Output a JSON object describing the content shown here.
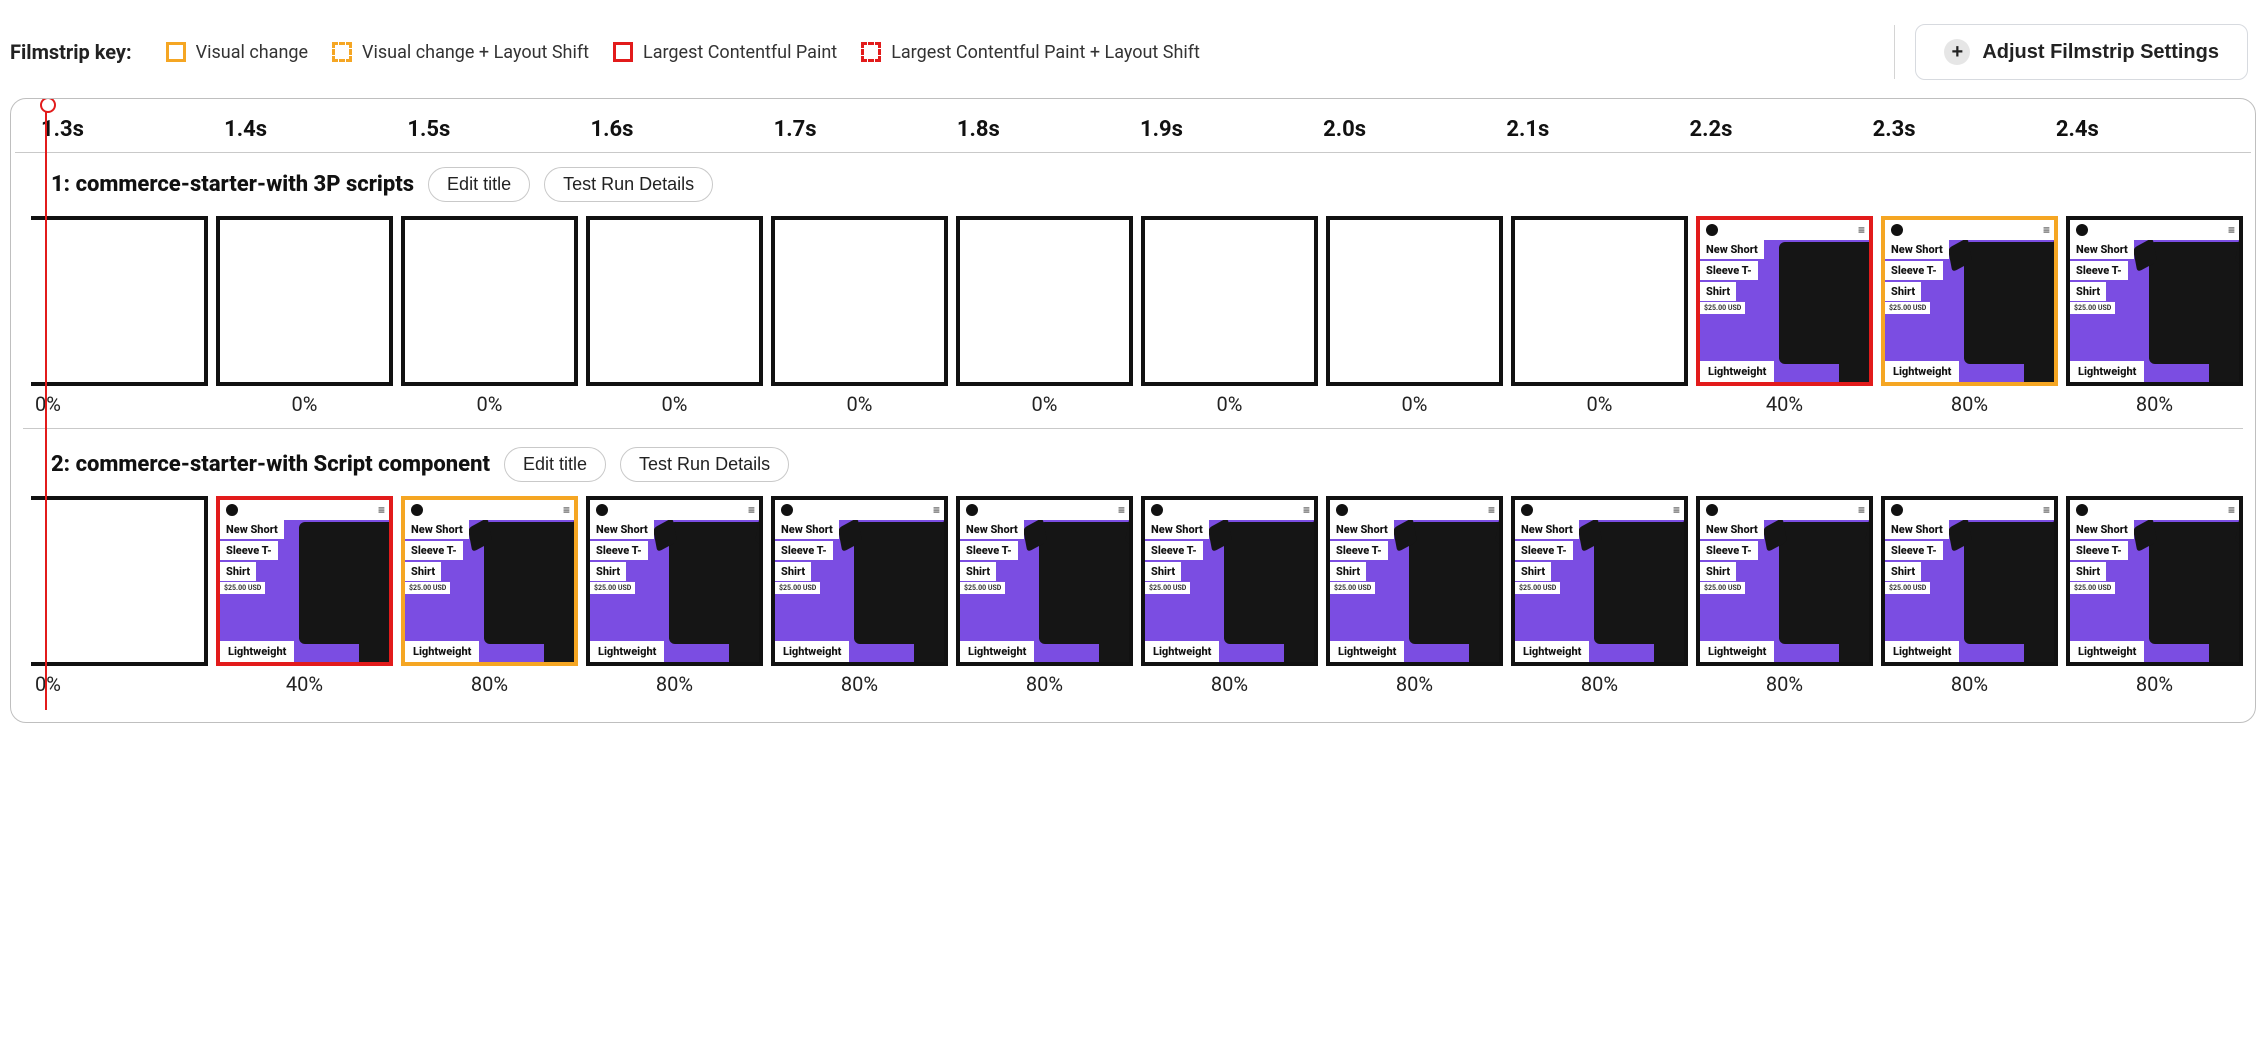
{
  "key": {
    "label": "Filmstrip key:",
    "visual": "Visual change",
    "visualShift": "Visual change + Layout Shift",
    "lcp": "Largest Contentful Paint",
    "lcpShift": "Largest Contentful Paint + Layout Shift"
  },
  "settingsBtn": "Adjust Filmstrip Settings",
  "timeline": [
    "1.3s",
    "1.4s",
    "1.5s",
    "1.6s",
    "1.7s",
    "1.8s",
    "1.9s",
    "2.0s",
    "2.1s",
    "2.2s",
    "2.3s",
    "2.4s"
  ],
  "editTitle": "Edit title",
  "testRunDetails": "Test Run Details",
  "product": {
    "line1": "New Short",
    "line2": "Sleeve T-",
    "line3": "Shirt",
    "price": "$25.00 USD",
    "tag": "Lightweight"
  },
  "runs": [
    {
      "title": "1: commerce-starter-with 3P scripts",
      "frames": [
        {
          "pct": "0%",
          "content": false,
          "border": "black",
          "firstcut": true
        },
        {
          "pct": "0%",
          "content": false,
          "border": "black"
        },
        {
          "pct": "0%",
          "content": false,
          "border": "black"
        },
        {
          "pct": "0%",
          "content": false,
          "border": "black"
        },
        {
          "pct": "0%",
          "content": false,
          "border": "black"
        },
        {
          "pct": "0%",
          "content": false,
          "border": "black"
        },
        {
          "pct": "0%",
          "content": false,
          "border": "black"
        },
        {
          "pct": "0%",
          "content": false,
          "border": "black"
        },
        {
          "pct": "0%",
          "content": false,
          "border": "black"
        },
        {
          "pct": "40%",
          "content": true,
          "border": "red",
          "sleeves": false
        },
        {
          "pct": "80%",
          "content": true,
          "border": "orange",
          "sleeves": true
        },
        {
          "pct": "80%",
          "content": true,
          "border": "black",
          "sleeves": true
        }
      ]
    },
    {
      "title": "2: commerce-starter-with Script component",
      "frames": [
        {
          "pct": "0%",
          "content": false,
          "border": "black",
          "firstcut": true
        },
        {
          "pct": "40%",
          "content": true,
          "border": "red",
          "sleeves": false
        },
        {
          "pct": "80%",
          "content": true,
          "border": "orange",
          "sleeves": true
        },
        {
          "pct": "80%",
          "content": true,
          "border": "black",
          "sleeves": true
        },
        {
          "pct": "80%",
          "content": true,
          "border": "black",
          "sleeves": true
        },
        {
          "pct": "80%",
          "content": true,
          "border": "black",
          "sleeves": true
        },
        {
          "pct": "80%",
          "content": true,
          "border": "black",
          "sleeves": true
        },
        {
          "pct": "80%",
          "content": true,
          "border": "black",
          "sleeves": true
        },
        {
          "pct": "80%",
          "content": true,
          "border": "black",
          "sleeves": true
        },
        {
          "pct": "80%",
          "content": true,
          "border": "black",
          "sleeves": true
        },
        {
          "pct": "80%",
          "content": true,
          "border": "black",
          "sleeves": true
        },
        {
          "pct": "80%",
          "content": true,
          "border": "black",
          "sleeves": true
        }
      ]
    }
  ]
}
